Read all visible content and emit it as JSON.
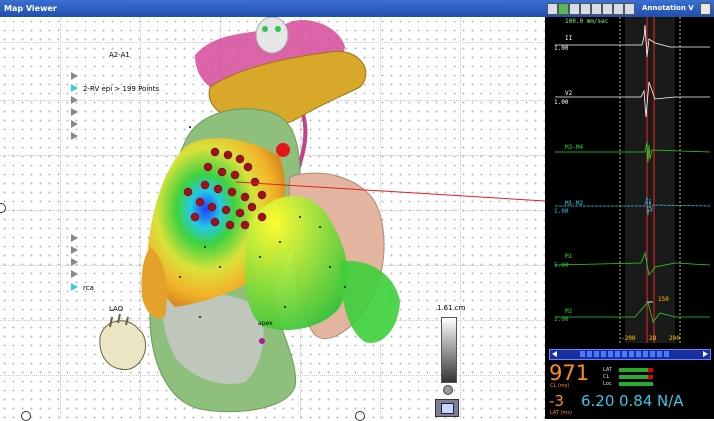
{
  "map_viewer": {
    "window_title": "Map Viewer",
    "map_label": "A2-A1",
    "view_label": "LAO",
    "points_label": "2-RV epi > 199 Points",
    "map_name_rca": "rca",
    "apex_label": "apex",
    "scale_label": "1.61 cm"
  },
  "annotation": {
    "window_title": "Annotation V",
    "sweep_speed": "100.0 mm/sec",
    "channels": [
      {
        "name": "II",
        "gain": "1.00",
        "color": "#ffffff"
      },
      {
        "name": "V2",
        "gain": "1.00",
        "color": "#ffffff"
      },
      {
        "name": "M3-M4",
        "gain": "",
        "color": "#2bd42b"
      },
      {
        "name": "M1-M2",
        "gain": "1.00",
        "color": "#33c8e6"
      },
      {
        "name": "M1",
        "gain": "5.00",
        "color": "#2bd42b"
      },
      {
        "name": "M2",
        "gain": "1.00",
        "color": "#2bd42b"
      }
    ],
    "marker_150": "150",
    "time_axis": [
      "-200",
      "28",
      "200"
    ],
    "cycle_length": "971",
    "cl_units": "CL (ms)",
    "metric_labels": [
      "LAT",
      "CL",
      "Loc"
    ],
    "lat_value": "-3",
    "lat_units": "LAT (ms)",
    "v1": "6.20",
    "v2": "0.84",
    "v3": "N/A"
  }
}
